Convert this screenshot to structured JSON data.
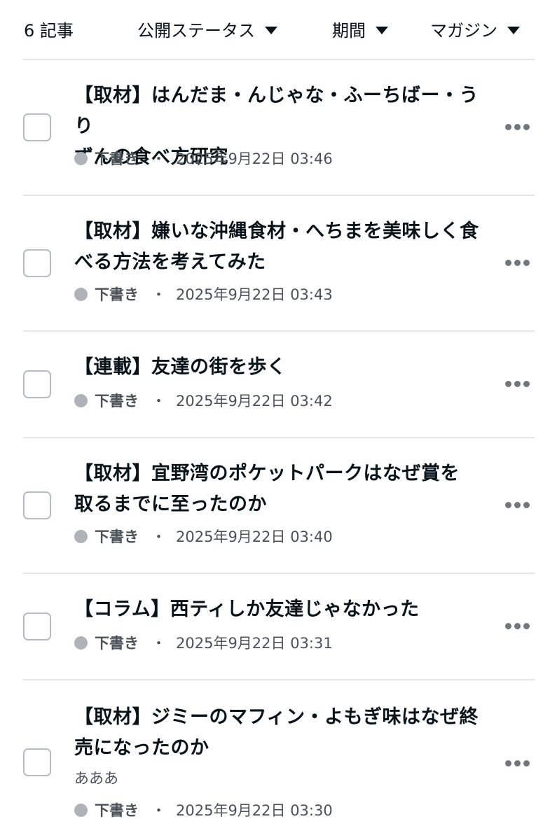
{
  "header": {
    "count": "6 記事",
    "filters": {
      "status": "公開ステータス",
      "period": "期間",
      "magazine": "マガジン"
    }
  },
  "articles": [
    {
      "title_line1": "【取材】はんだま・んじゃな・ふーちばー・うり",
      "title_line2": "ずんの食べ方研究",
      "status": "下書き",
      "separator": "・",
      "date": "2025年9月22日 03:46"
    },
    {
      "title_line1": "【取材】嫌いな沖縄食材・へちまを美味しく食",
      "title_line2": "べる方法を考えてみた",
      "status": "下書き",
      "separator": "・",
      "date": "2025年9月22日 03:43"
    },
    {
      "title_line1": "【連載】友達の街を歩く",
      "status": "下書き",
      "separator": "・",
      "date": "2025年9月22日 03:42"
    },
    {
      "title_line1": "【取材】宜野湾のポケットパークはなぜ賞を",
      "title_line2": "取るまでに至ったのか",
      "status": "下書き",
      "separator": "・",
      "date": "2025年9月22日 03:40"
    },
    {
      "title_line1": "【コラム】西ティしか友達じゃなかった",
      "status": "下書き",
      "separator": "・",
      "date": "2025年9月22日 03:31"
    },
    {
      "title_line1": "【取材】ジミーのマフィン・よもぎ味はなぜ終",
      "title_line2": "売になったのか",
      "excerpt": "あああ",
      "status": "下書き",
      "separator": "・",
      "date": "2025年9月22日 03:30"
    }
  ]
}
